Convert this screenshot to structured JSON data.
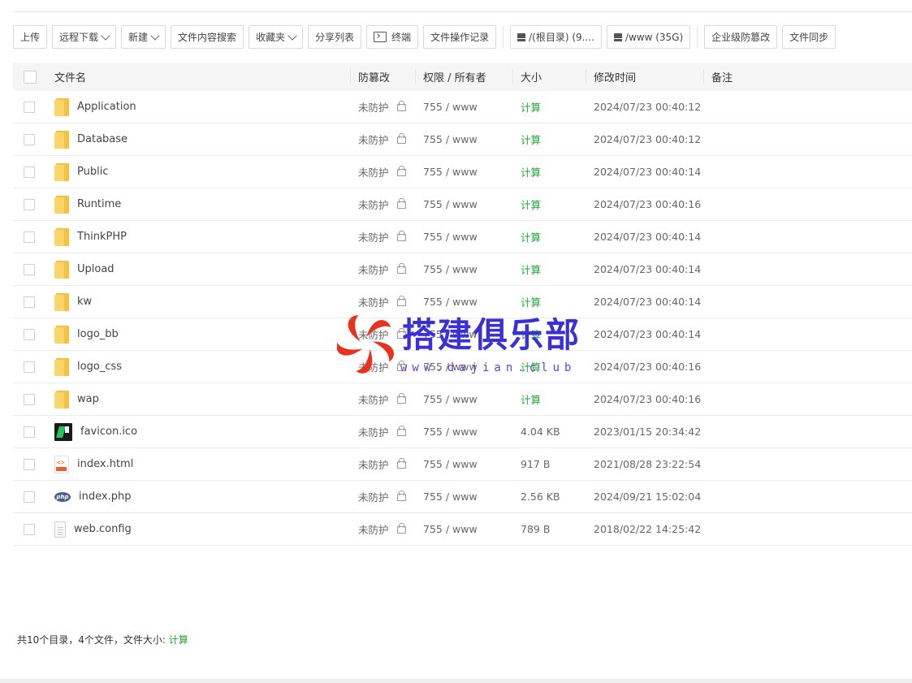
{
  "toolbar": {
    "upload": "上传",
    "remote_download": "远程下载",
    "new": "新建",
    "content_search": "文件内容搜索",
    "favorites": "收藏夹",
    "share_list": "分享列表",
    "terminal": "终端",
    "operation_log": "文件操作记录",
    "root_disk": "/(根目录) (9....",
    "www_disk": "/www (35G)",
    "anti_tamper": "企业级防篡改",
    "file_sync": "文件同步"
  },
  "table": {
    "headers": {
      "name": "文件名",
      "protect": "防篡改",
      "perm": "权限 / 所有者",
      "size": "大小",
      "mtime": "修改时间",
      "note": "备注"
    },
    "rows": [
      {
        "name": "Application",
        "icon": "folder-icon",
        "protect": "未防护",
        "perm": "755 / www",
        "size": "计算",
        "mtime": "2024/07/23 00:40:12",
        "note": ""
      },
      {
        "name": "Database",
        "icon": "folder-icon",
        "protect": "未防护",
        "perm": "755 / www",
        "size": "计算",
        "mtime": "2024/07/23 00:40:12",
        "note": ""
      },
      {
        "name": "Public",
        "icon": "folder-icon",
        "protect": "未防护",
        "perm": "755 / www",
        "size": "计算",
        "mtime": "2024/07/23 00:40:14",
        "note": ""
      },
      {
        "name": "Runtime",
        "icon": "folder-icon",
        "protect": "未防护",
        "perm": "755 / www",
        "size": "计算",
        "mtime": "2024/07/23 00:40:16",
        "note": ""
      },
      {
        "name": "ThinkPHP",
        "icon": "folder-icon",
        "protect": "未防护",
        "perm": "755 / www",
        "size": "计算",
        "mtime": "2024/07/23 00:40:14",
        "note": ""
      },
      {
        "name": "Upload",
        "icon": "folder-icon",
        "protect": "未防护",
        "perm": "755 / www",
        "size": "计算",
        "mtime": "2024/07/23 00:40:14",
        "note": ""
      },
      {
        "name": "kw",
        "icon": "folder-icon",
        "protect": "未防护",
        "perm": "755 / www",
        "size": "计算",
        "mtime": "2024/07/23 00:40:14",
        "note": ""
      },
      {
        "name": "logo_bb",
        "icon": "folder-icon",
        "protect": "未防护",
        "perm": "755 / www",
        "size": "计算",
        "mtime": "2024/07/23 00:40:14",
        "note": ""
      },
      {
        "name": "logo_css",
        "icon": "folder-icon",
        "protect": "未防护",
        "perm": "755 / www",
        "size": "计算",
        "mtime": "2024/07/23 00:40:16",
        "note": ""
      },
      {
        "name": "wap",
        "icon": "folder-icon",
        "protect": "未防护",
        "perm": "755 / www",
        "size": "计算",
        "mtime": "2024/07/23 00:40:16",
        "note": ""
      },
      {
        "name": "favicon.ico",
        "icon": "favicon-file-icon",
        "protect": "未防护",
        "perm": "755 / www",
        "size": "4.04 KB",
        "mtime": "2023/01/15 20:34:42",
        "note": ""
      },
      {
        "name": "index.html",
        "icon": "html-file-icon",
        "protect": "未防护",
        "perm": "755 / www",
        "size": "917 B",
        "mtime": "2021/08/28 23:22:54",
        "note": ""
      },
      {
        "name": "index.php",
        "icon": "php-file-icon",
        "protect": "未防护",
        "perm": "755 / www",
        "size": "2.56 KB",
        "mtime": "2024/09/21 15:02:04",
        "note": ""
      },
      {
        "name": "web.config",
        "icon": "text-file-icon",
        "protect": "未防护",
        "perm": "755 / www",
        "size": "789 B",
        "mtime": "2018/02/22 14:25:42",
        "note": ""
      }
    ]
  },
  "footer": {
    "summary": "共10个目录，4个文件，文件大小:",
    "calc": "计算"
  },
  "watermark": {
    "title": "搭建俱乐部",
    "url": "www.dajian.club"
  },
  "colors": {
    "accent_green": "#20a53a",
    "folder_yellow": "#f5c23e",
    "watermark_blue": "#3b2fd6",
    "watermark_red": "#e8321e"
  }
}
